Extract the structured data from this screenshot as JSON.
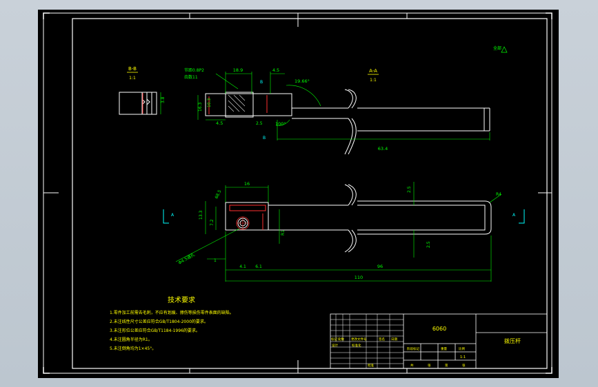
{
  "views": {
    "section_b_label": "B-B",
    "section_b_scale": "1:1",
    "section_a_label": "A-A",
    "section_a_scale": "1:1"
  },
  "dimensions": {
    "d_18_9": "18.9",
    "d_4_5_top": "4.5",
    "d_angle_19": "19.66°",
    "d_angle_100": "100°",
    "d_63_4": "63.4",
    "d_16_3": "16.3",
    "d_10_3": "10.3",
    "d_4_5_left": "4.5",
    "d_3_8": "3.8",
    "d_thread_note": "节距0.8P2",
    "d_thread_note2": "齿数11",
    "d_16": "16",
    "d_68_5": "68.5",
    "d_2_5_a": "2.5",
    "d_2_5_b": "2.5",
    "d_13_3": "13.3",
    "d_7_2": "7.2",
    "d_96": "96",
    "d_110": "110",
    "d_r4": "R4",
    "d_4_1": "4.1",
    "d_6_1": "6.1",
    "d_hole_note": "Φ4.5通孔",
    "d_1": "1",
    "d_r1": "R1",
    "surface": "全部"
  },
  "section_markers": {
    "left_a": "A",
    "right_a": "A",
    "b_top": "B",
    "b_bottom": "B"
  },
  "tech": {
    "title": "技术要求",
    "lines": [
      "1.零件加工前需去毛刺，不应有划痕、擦伤等损伤零件表面的缺陷。",
      "2.未注线性尺寸公差应符合GB/T1804-2000的要求。",
      "3.未注形位公差应符合GB/T1184-1996的要求。",
      "4.未注圆角半径为R1。",
      "5.未注倒角均为1×45°。"
    ]
  },
  "title_block": {
    "material": "6060",
    "part_name": "拨压杆",
    "scale": "1:1",
    "row_labels": [
      "标记",
      "处数",
      "更改文件号",
      "签名",
      "日期"
    ],
    "row_labels2": [
      "设计",
      "标准化"
    ],
    "stage_labels": [
      "阶段标记",
      "重量",
      "比例"
    ],
    "bottom_labels": [
      "共",
      "张",
      "第",
      "张"
    ],
    "approve": "批准"
  },
  "colors": {
    "outline": "#ffffff",
    "dimension": "#00ff00",
    "hatch": "#e0e0e0",
    "center": "#ff3030",
    "marker": "#00ffff",
    "label": "#ffff00",
    "background": "#000000"
  }
}
